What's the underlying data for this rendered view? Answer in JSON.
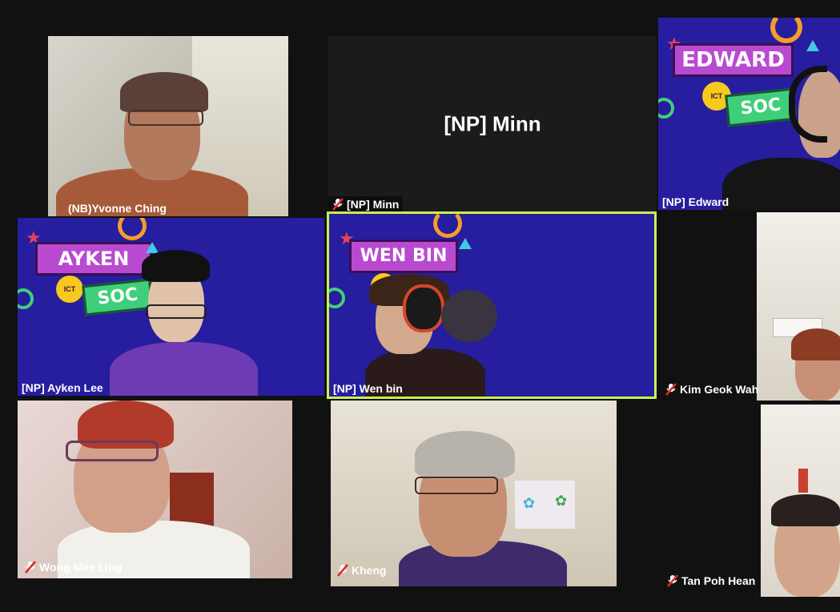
{
  "participants": [
    {
      "name": "(NB)Yvonne Ching",
      "muted": false
    },
    {
      "name": "[NP] Minn",
      "muted": true,
      "display_name": "[NP] Minn"
    },
    {
      "name": "[NP] Edward",
      "muted": false,
      "banner": "EDWARD",
      "banner2": "SOC",
      "badge": "ICT"
    },
    {
      "name": "[NP] Ayken Lee",
      "muted": false,
      "banner": "AYKEN",
      "banner2": "SOC",
      "badge": "ICT"
    },
    {
      "name": "[NP] Wen bin",
      "muted": false,
      "banner": "WEN BIN",
      "badge": "ICT",
      "active_speaker": true
    },
    {
      "name": "Kim Geok Wah",
      "muted": true
    },
    {
      "name": "Wong Mee Ling",
      "muted": true
    },
    {
      "name": "Kheng",
      "muted": true
    },
    {
      "name": "Tan Poh Hean",
      "muted": true
    }
  ],
  "colors": {
    "active_border": "#c8f051",
    "background": "#111112",
    "banner_purple": "#b94ad0",
    "banner_green": "#3fcf7a",
    "virtual_bg": "#261e9e"
  }
}
